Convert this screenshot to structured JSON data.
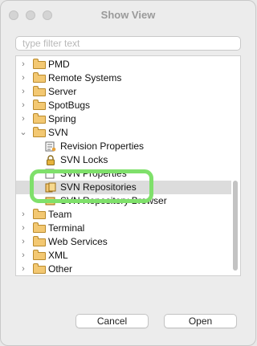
{
  "window": {
    "title": "Show View"
  },
  "filter": {
    "placeholder": "type filter text",
    "value": ""
  },
  "tree": {
    "rows": [
      {
        "label": "PMD",
        "chevron": "›"
      },
      {
        "label": "Remote Systems",
        "chevron": "›"
      },
      {
        "label": "Server",
        "chevron": "›"
      },
      {
        "label": "SpotBugs",
        "chevron": "›"
      },
      {
        "label": "Spring",
        "chevron": "›"
      },
      {
        "label": "SVN",
        "chevron": "⌄"
      },
      {
        "label": "Revision Properties"
      },
      {
        "label": "SVN Locks"
      },
      {
        "label": "SVN Properties"
      },
      {
        "label": "SVN Repositories",
        "selected": true
      },
      {
        "label": "SVN Repository Browser"
      },
      {
        "label": "Team",
        "chevron": "›"
      },
      {
        "label": "Terminal",
        "chevron": "›"
      },
      {
        "label": "Web Services",
        "chevron": "›"
      },
      {
        "label": "XML",
        "chevron": "›"
      },
      {
        "label": "Other",
        "chevron": "›"
      }
    ]
  },
  "buttons": {
    "cancel": "Cancel",
    "open": "Open"
  },
  "colors": {
    "highlight": "#7fe06b",
    "selection": "#dcdcdc",
    "folder": "#f3c872"
  }
}
